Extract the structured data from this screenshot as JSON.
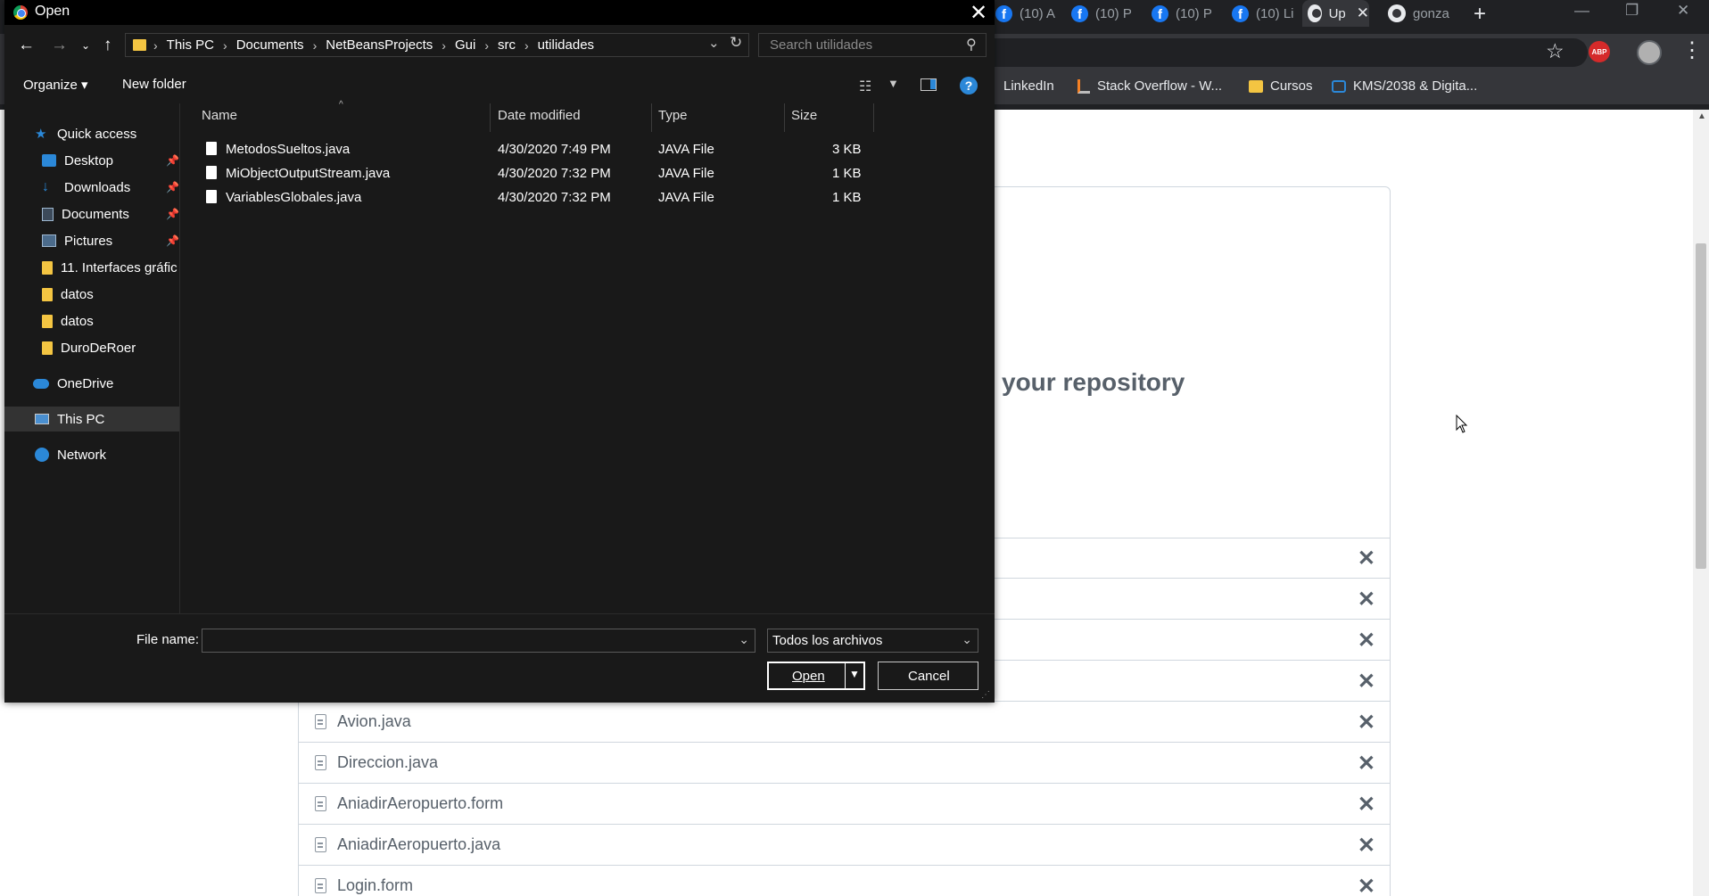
{
  "browser": {
    "tabs": [
      {
        "label": "(10) A",
        "icon": "facebook-icon"
      },
      {
        "label": "(10) P",
        "icon": "facebook-icon"
      },
      {
        "label": "(10) P",
        "icon": "facebook-icon"
      },
      {
        "label": "(10) Li",
        "icon": "facebook-icon"
      },
      {
        "label": "Up",
        "icon": "github-icon",
        "active": true
      },
      {
        "label": "gonza",
        "icon": "github-icon"
      }
    ],
    "bookmarks": [
      {
        "label": "LinkedIn"
      },
      {
        "label": "Stack Overflow - W..."
      },
      {
        "label": "Cursos"
      },
      {
        "label": "KMS/2038 & Digita..."
      }
    ],
    "abp_label": "ABP"
  },
  "page": {
    "drop_text": "your repository",
    "files": [
      "Avion.java",
      "Direccion.java",
      "AniadirAeropuerto.form",
      "AniadirAeropuerto.java",
      "Login.form"
    ]
  },
  "dialog": {
    "title": "Open",
    "breadcrumb": [
      "This PC",
      "Documents",
      "NetBeansProjects",
      "Gui",
      "src",
      "utilidades"
    ],
    "search_placeholder": "Search utilidades",
    "organize_label": "Organize ▾",
    "new_folder_label": "New folder",
    "help_label": "?",
    "nav_pane": {
      "quick_access": "Quick access",
      "items": [
        "Desktop",
        "Downloads",
        "Documents",
        "Pictures",
        "11. Interfaces gráfic",
        "datos",
        "datos",
        "DuroDeRoer"
      ],
      "onedrive": "OneDrive",
      "this_pc": "This PC",
      "network": "Network"
    },
    "columns": {
      "name": "Name",
      "date": "Date modified",
      "type": "Type",
      "size": "Size"
    },
    "files": [
      {
        "name": "MetodosSueltos.java",
        "date": "4/30/2020 7:49 PM",
        "type": "JAVA File",
        "size": "3 KB"
      },
      {
        "name": "MiObjectOutputStream.java",
        "date": "4/30/2020 7:32 PM",
        "type": "JAVA File",
        "size": "1 KB"
      },
      {
        "name": "VariablesGlobales.java",
        "date": "4/30/2020 7:32 PM",
        "type": "JAVA File",
        "size": "1 KB"
      }
    ],
    "file_name_label": "File name:",
    "file_name_value": "",
    "file_type": "Todos los archivos",
    "open_label": "Open",
    "cancel_label": "Cancel"
  },
  "colors": {
    "dialog_bg": "#191919",
    "browser_frame": "#202124",
    "accent": "#2b88d8",
    "facebook": "#1877f2",
    "abp_red": "#d52a2a",
    "folder_yellow": "#f4c542"
  }
}
